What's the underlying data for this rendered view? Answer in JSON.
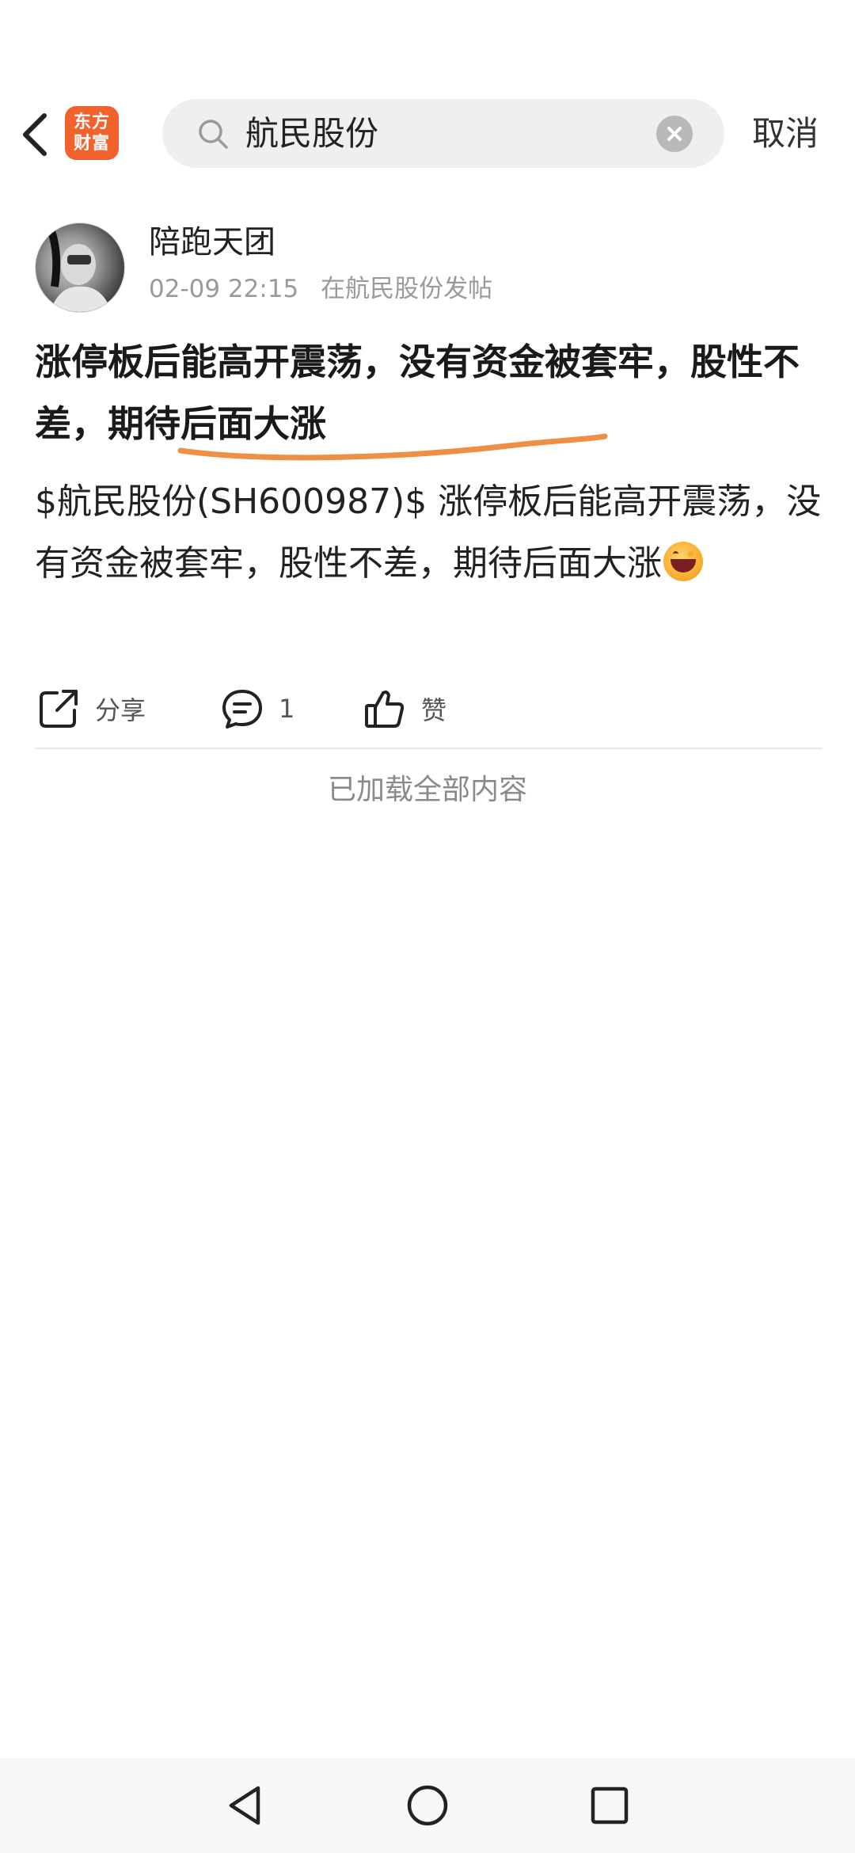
{
  "header": {
    "app_logo_line1": "东方",
    "app_logo_line2": "财富",
    "search_value": "航民股份",
    "cancel_label": "取消"
  },
  "post": {
    "author": "陪跑天团",
    "time": "02-09 22:15",
    "source": "在航民股份发帖",
    "title": "涨停板后能高开震荡，没有资金被套牢，股性不差，期待后面大涨",
    "body": "$航民股份(SH600987)$ 涨停板后能高开震荡，没有资金被套牢，股性不差，期待后面大涨",
    "emoji": "grinning-squint-emoji"
  },
  "actions": {
    "share_label": "分享",
    "comment_count": "1",
    "like_label": "赞"
  },
  "footer_note": "已加载全部内容",
  "colors": {
    "brand_orange": "#f2622c",
    "underline_orange": "#ef8f45",
    "search_bg": "#efefef"
  },
  "icons": {
    "back": "chevron-left-icon",
    "search": "search-icon",
    "clear": "clear-icon",
    "share": "share-icon",
    "comment": "comment-icon",
    "like": "thumbs-up-icon",
    "nav_back": "triangle-back-icon",
    "nav_home": "circle-home-icon",
    "nav_recent": "square-recent-icon"
  }
}
